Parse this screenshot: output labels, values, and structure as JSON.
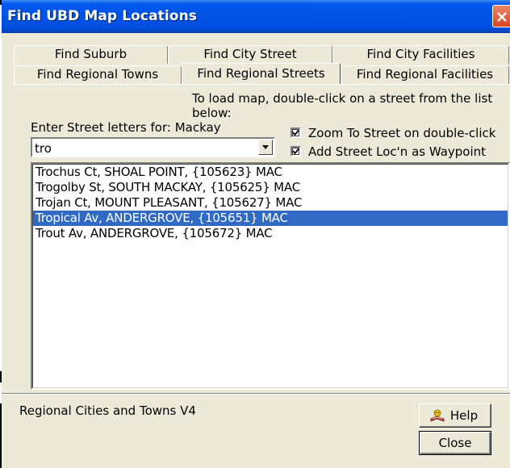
{
  "window": {
    "title": "Find UBD Map Locations"
  },
  "tabs": {
    "row_back": [
      "Find Suburb",
      "Find City Street",
      "Find City Facilities"
    ],
    "row_front": [
      "Find Regional Towns",
      "Find Regional Streets",
      "Find Regional Facilities"
    ],
    "active": "Find Regional Streets"
  },
  "hint": "To load map, double-click on a street from the list below:",
  "search": {
    "label": "Enter Street letters for: Mackay",
    "value": "tro"
  },
  "options": {
    "zoom_label": "Zoom To Street on double-click",
    "zoom_checked": true,
    "waypoint_label": "Add Street Loc'n as Waypoint",
    "waypoint_checked": true
  },
  "streets": [
    "Trochus Ct, SHOAL POINT, {105623} MAC",
    "Trogolby St, SOUTH MACKAY, {105625} MAC",
    "Trojan Ct, MOUNT PLEASANT, {105627} MAC",
    "Tropical Av, ANDERGROVE, {105651} MAC",
    "Trout Av, ANDERGROVE, {105672} MAC"
  ],
  "selected_street": "Tropical Av, ANDERGROVE, {105651} MAC",
  "footer": {
    "status": "Regional Cities and Towns V4",
    "help_label": "Help",
    "close_label": "Close"
  },
  "colors": {
    "titlebar": "#0054e3",
    "selection": "#316ac5",
    "face": "#ece9d8",
    "close": "#d9431c"
  }
}
